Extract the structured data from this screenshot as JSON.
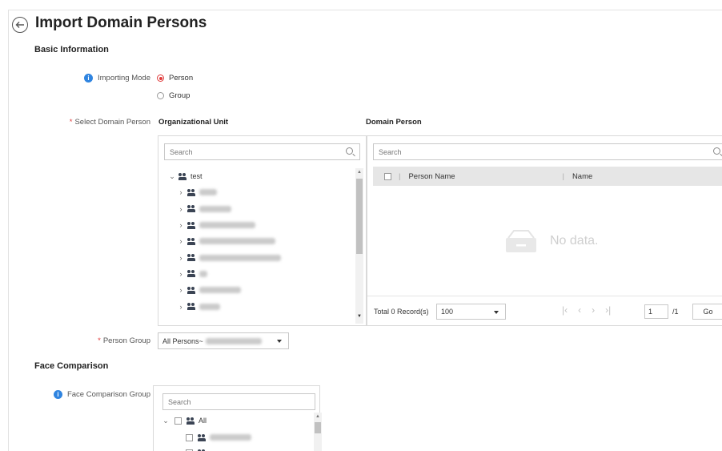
{
  "header": {
    "title": "Import Domain Persons"
  },
  "basic_info": {
    "title": "Basic Information",
    "importing_mode": {
      "label": "Importing Mode",
      "options": [
        {
          "label": "Person",
          "selected": true
        },
        {
          "label": "Group",
          "selected": false
        }
      ]
    },
    "select_domain_person": {
      "label": "Select Domain Person",
      "required_mark": "*",
      "org_unit": {
        "title": "Organizational Unit",
        "search_placeholder": "Search",
        "tree_root": "test"
      },
      "domain_person": {
        "title": "Domain Person",
        "search_placeholder": "Search",
        "columns": [
          "Person Name",
          "Name"
        ],
        "empty_text": "No data.",
        "footer": {
          "total": "Total 0 Record(s)",
          "page_size": "100",
          "page_input": "1",
          "page_total": "/1",
          "go_label": "Go"
        }
      }
    },
    "person_group": {
      "label": "Person Group",
      "required_mark": "*",
      "value": "All Persons~"
    }
  },
  "face_comparison": {
    "title": "Face Comparison",
    "group": {
      "label": "Face Comparison Group",
      "search_placeholder": "Search",
      "tree_root": "All"
    }
  },
  "colors": {
    "accent_red": "#e03a3a",
    "info_blue": "#2f84e0"
  },
  "icons": [
    "back-arrow-icon",
    "info-icon",
    "search-icon",
    "chevron-right-icon",
    "chevron-down-icon",
    "person-group-icon",
    "folder-empty-icon",
    "first-page-icon",
    "prev-page-icon",
    "next-page-icon",
    "last-page-icon"
  ]
}
